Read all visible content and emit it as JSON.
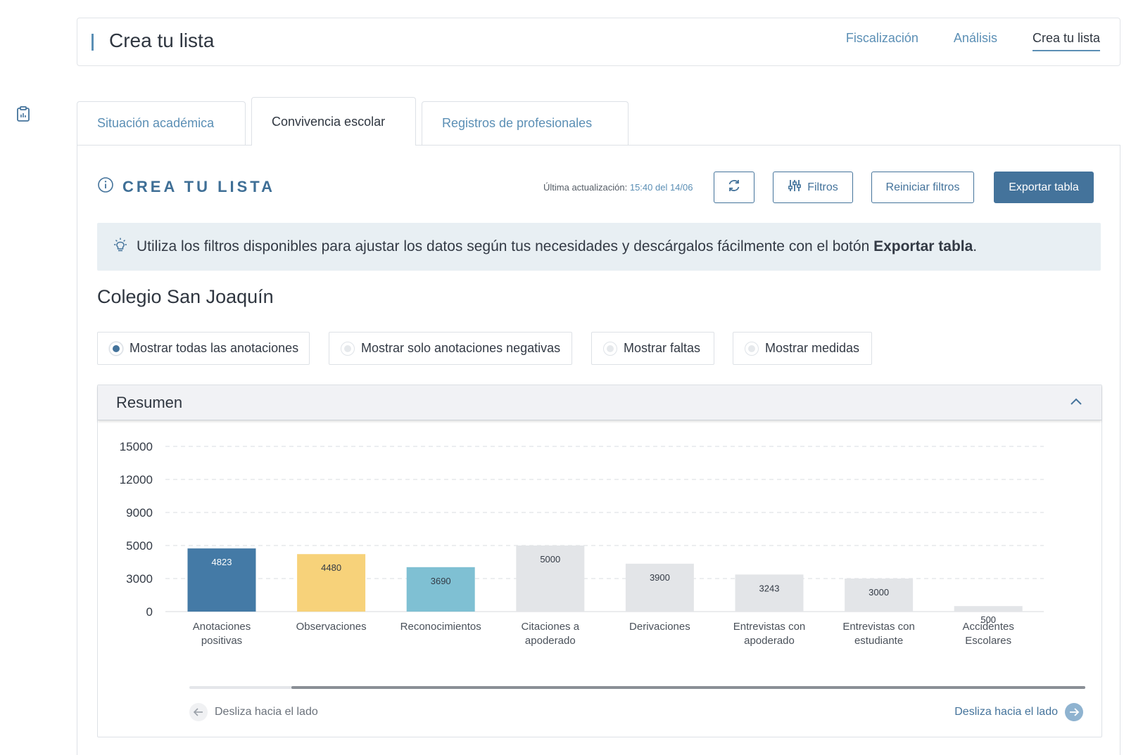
{
  "header": {
    "title": "Crea tu lista",
    "nav": [
      "Fiscalización",
      "Análisis",
      "Crea tu lista"
    ]
  },
  "tabs": [
    "Situación académica",
    "Convivencia escolar",
    "Registros de profesionales"
  ],
  "section": {
    "title": "CREA TU LISTA",
    "update_label": "Última actualización:",
    "update_value": "15:40 del 14/06"
  },
  "buttons": {
    "filters": "Filtros",
    "reset": "Reiniciar filtros",
    "export": "Exportar tabla"
  },
  "hint": {
    "text": "Utiliza los filtros disponibles para ajustar los datos según tus necesidades y descárgalos fácilmente con el botón ",
    "bold": "Exportar tabla",
    "end": "."
  },
  "school": "Colegio San Joaquín",
  "options": [
    {
      "label": "Mostrar todas las anotaciones",
      "selected": true
    },
    {
      "label": "Mostrar solo anotaciones negativas",
      "selected": false
    },
    {
      "label": "Mostrar faltas",
      "selected": false
    },
    {
      "label": "Mostrar medidas",
      "selected": false
    }
  ],
  "summary": {
    "title": "Resumen",
    "slide_left": "Desliza hacia el lado",
    "slide_right": "Desliza hacia el lado"
  },
  "colors": {
    "accent": "#44739b",
    "bar_dark": "#447aa6",
    "bar_yellow": "#f7d27a",
    "bar_teal": "#7fc0d3",
    "bar_gray": "#e3e5e8"
  },
  "chart_data": {
    "type": "bar",
    "categories": [
      [
        "Anotaciones",
        "positivas"
      ],
      [
        "Observaciones"
      ],
      [
        "Reconocimientos"
      ],
      [
        "Citaciones a",
        "apoderado"
      ],
      [
        "Derivaciones"
      ],
      [
        "Entrevistas con",
        "apoderado"
      ],
      [
        "Entrevistas con",
        "estudiante"
      ],
      [
        "Accidentes",
        "Escolares"
      ]
    ],
    "values": [
      4823,
      4480,
      3690,
      5000,
      3900,
      3243,
      3000,
      500
    ],
    "bar_colors": [
      "#447aa6",
      "#f7d27a",
      "#7fc0d3",
      "#e3e5e8",
      "#e3e5e8",
      "#e3e5e8",
      "#e3e5e8",
      "#e3e5e8"
    ],
    "y_ticks": [
      0,
      3000,
      5000,
      9000,
      12000,
      15000
    ],
    "grid": true
  }
}
